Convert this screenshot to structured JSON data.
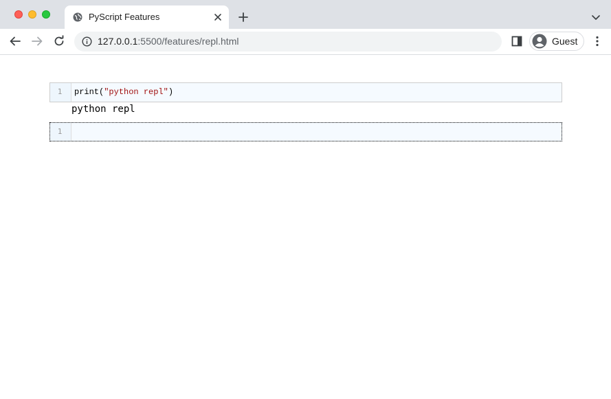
{
  "browser": {
    "tab": {
      "title": "PyScript Features",
      "favicon": "globe-icon"
    },
    "address_bar": {
      "host": "127.0.0.1",
      "path": ":5500/features/repl.html"
    },
    "profile": {
      "label": "Guest"
    },
    "colors": {
      "tabstrip": "#dee1e6",
      "omnibox": "#f1f3f4"
    }
  },
  "repl": {
    "cells": [
      {
        "line_number": "1",
        "code_func": "print(",
        "code_string": "\"python repl\"",
        "code_close": ")",
        "output": "python repl"
      },
      {
        "line_number": "1",
        "code": ""
      }
    ],
    "colors": {
      "cell_bg": "#f5faff",
      "string": "#a11111"
    }
  }
}
